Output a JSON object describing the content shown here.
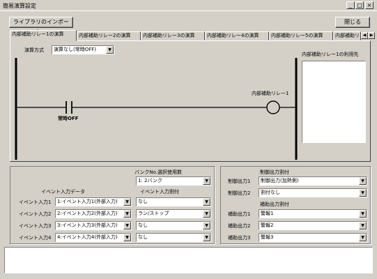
{
  "window": {
    "title": "簡易演算設定",
    "min": "_",
    "max": "□",
    "close": "×"
  },
  "toolbar": {
    "import_label": "ライブラリのインポート...",
    "close_label": "閉じる"
  },
  "tabs": [
    "内部補助リレー1の演算",
    "内部補助リレー2の演算",
    "内部補助リレー3の演算",
    "内部補助リレー4の演算",
    "内部補助リレー5の演算",
    "内部補助リレー"
  ],
  "tab_scroll": {
    "left": "◀",
    "right": "▶"
  },
  "ladder": {
    "method_label": "演算方式",
    "method_value": "演算なし(常時OFF)",
    "contact_label": "常時OFF",
    "coil_label": "内部補助リレー1",
    "usage_title": "内部補助リレー1の利用先"
  },
  "bank": {
    "label": "バンクNo.選択使用数",
    "value": "1: 2バンク"
  },
  "event_input": {
    "data_header": "イベント入力データ",
    "assign_header": "イベント入力割付",
    "rows": [
      {
        "label": "イベント入力1",
        "data": "1:イベント入力1(外部入力)",
        "assign": "なし"
      },
      {
        "label": "イベント入力2",
        "data": "2:イベント入力2(外部入力)",
        "assign": "ラン/ストップ"
      },
      {
        "label": "イベント入力3",
        "data": "3:イベント入力3(外部入力)",
        "assign": "なし"
      },
      {
        "label": "イベント入力4",
        "data": "4:イベント入力4(外部入力)",
        "assign": "なし"
      }
    ]
  },
  "control_output": {
    "header": "制御出力割付",
    "rows": [
      {
        "label": "制御出力1",
        "value": "制御出力(加熱側)"
      },
      {
        "label": "制御出力2",
        "value": "割付なし"
      }
    ]
  },
  "aux_output": {
    "header": "補助出力割付",
    "rows": [
      {
        "label": "補助出力1",
        "value": "警報1"
      },
      {
        "label": "補助出力2",
        "value": "警報2"
      },
      {
        "label": "補助出力3",
        "value": "警報3"
      }
    ]
  },
  "dropdown_arrow": "▼"
}
